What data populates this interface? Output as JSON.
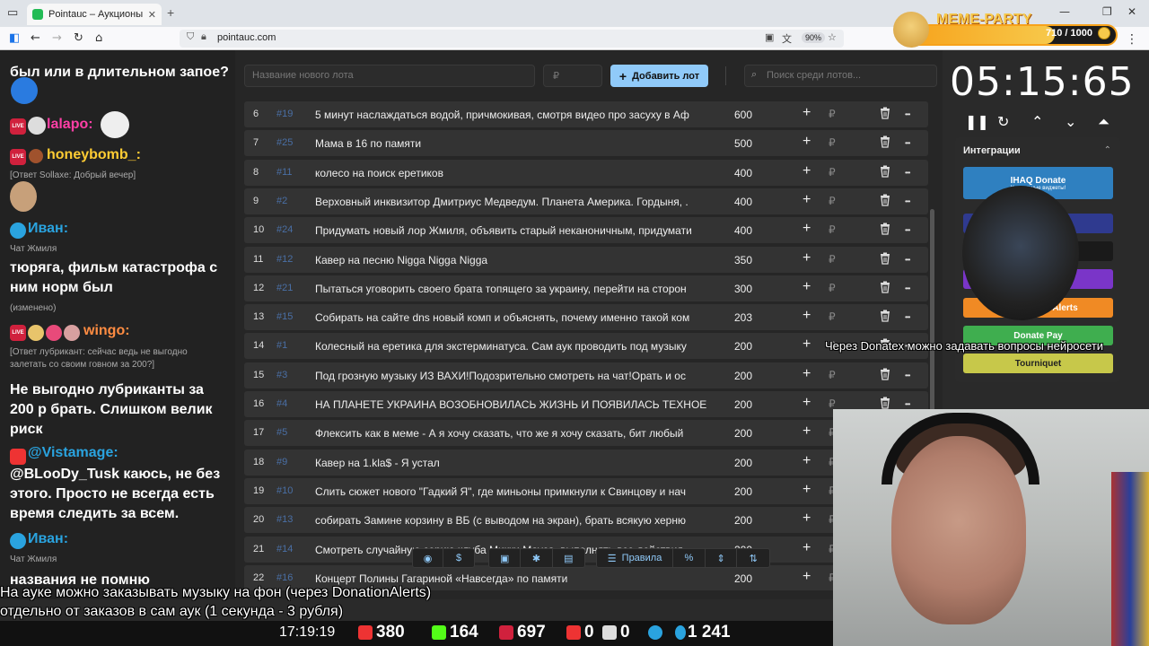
{
  "browser": {
    "tab_title": "Pointauc – Аукционы, лотереи",
    "tab_close": "✕",
    "new_tab": "+",
    "url": "pointauc.com",
    "zoom": "90%"
  },
  "chat": {
    "top_fragment": "был или в длительном запое?",
    "messages": [
      {
        "nick": "lalapo:",
        "nick_color": "#ff3fa6",
        "badge": "live"
      },
      {
        "nick": "honeybomb_:",
        "nick_color": "#ffcc33",
        "badge": "live",
        "meta": "[Ответ Sollaxe: Добрый вечер]"
      },
      {
        "nick": "Иван:",
        "nick_color": "#2aa3df",
        "badge": "tg",
        "meta": "Чат Жмиля",
        "text": "тюряга, фильм катастрофа с ним норм был",
        "meta2": "(изменено)"
      },
      {
        "nick": "wingo:",
        "nick_color": "#ff8c42",
        "badge": "live",
        "meta": "[Ответ лубрикант: сейчас ведь не выгодно залетать со своим говном за 200?]",
        "text": "Не выгодно лубриканты за 200 р брать. Слишком велик риск"
      },
      {
        "nick": "@Vistamage:",
        "nick_color": "#2aa3df",
        "badge": "yt",
        "text": "@BLooDy_Tusk каюсь, не без этого. Просто не всегда есть время следить за всем."
      },
      {
        "nick": "Иван:",
        "nick_color": "#2aa3df",
        "badge": "tg",
        "meta": "Чат Жмиля",
        "text": "названия не помню"
      }
    ]
  },
  "lots": {
    "new_lot_placeholder": "Название нового лота",
    "price_placeholder": "₽",
    "add_button": "Добавить лот",
    "search_placeholder": "Поиск среди лотов...",
    "currency": "₽",
    "rows": [
      {
        "n": "6",
        "id": "#19",
        "name": "5 минут наслаждаться водой, причмокивая, смотря видео про засуху в Аф",
        "amount": "600"
      },
      {
        "n": "7",
        "id": "#25",
        "name": "Мама в 16 по памяти",
        "amount": "500"
      },
      {
        "n": "8",
        "id": "#11",
        "name": "колесо на поиск еретиков",
        "amount": "400"
      },
      {
        "n": "9",
        "id": "#2",
        "name": "Верховный инквизитор Дмитриус Медведум. Планета Америка. Гордыня, .",
        "amount": "400"
      },
      {
        "n": "10",
        "id": "#24",
        "name": "Придумать новый лор Жмиля, объявить старый неканоничным, придумати",
        "amount": "400"
      },
      {
        "n": "11",
        "id": "#12",
        "name": "Кавер на песню Nigga Nigga Nigga",
        "amount": "350"
      },
      {
        "n": "12",
        "id": "#21",
        "name": "Пытаться уговорить своего брата топящего за украину, перейти на сторон",
        "amount": "300"
      },
      {
        "n": "13",
        "id": "#15",
        "name": "Собирать на сайте dns новый комп и объяснять, почему именно такой ком",
        "amount": "203"
      },
      {
        "n": "14",
        "id": "#1",
        "name": "Колесный на еретика для экстерминатуса. Сам аук проводить под музыку",
        "amount": "200"
      },
      {
        "n": "15",
        "id": "#3",
        "name": "Под грозную музыку ИЗ ВАХИ!Подозрительно смотреть на чат!Орать и ос",
        "amount": "200"
      },
      {
        "n": "16",
        "id": "#4",
        "name": "НА ПЛАНЕТЕ УКРАИНА ВОЗОБНОВИЛАСЬ ЖИЗНЬ И ПОЯВИЛАСЬ ТЕХНОЕ",
        "amount": "200"
      },
      {
        "n": "17",
        "id": "#5",
        "name": "Флексить как в меме - А я хочу сказать, что же я хочу сказать, бит любый",
        "amount": "200"
      },
      {
        "n": "18",
        "id": "#9",
        "name": "Кавер на 1.kla$ - Я устал",
        "amount": "200"
      },
      {
        "n": "19",
        "id": "#10",
        "name": "Слить сюжет нового \"Гадкий Я\", где миньоны примкнули к Свинцову и нач",
        "amount": "200"
      },
      {
        "n": "20",
        "id": "#13",
        "name": "собирать Замине корзину в ВБ (с выводом на экран), брать всякую херню",
        "amount": "200"
      },
      {
        "n": "21",
        "id": "#14",
        "name": "Смотреть случайную серию клуба Микки Мауса, выполнять все действия,",
        "amount": "200"
      },
      {
        "n": "22",
        "id": "#16",
        "name": "Концерт Полины Гагариной «Навсегда» по памяти",
        "amount": "200"
      }
    ]
  },
  "toolbar": {
    "rules_label": "Правила"
  },
  "timer": {
    "value": "05:15:65"
  },
  "integrations": {
    "title": "Интеграции",
    "buttons": [
      {
        "label": "IHAQ Donate",
        "sub": "Уникальные виджеты!",
        "color": "#2f80c0"
      },
      {
        "label": "",
        "color": "#2f3a8f"
      },
      {
        "label": "",
        "color": "#1a1a1a"
      },
      {
        "label": "",
        "color": "#7a35c8"
      },
      {
        "label": "Alerts",
        "color": "#f08a24"
      },
      {
        "label": "Donate Pay",
        "color": "#3fae4f"
      },
      {
        "label": "Tourniquet",
        "color": "#c7c84a"
      }
    ]
  },
  "overlay": {
    "caption_line1": "На ауке можно заказывать музыку на фон (через DonationAlerts)",
    "caption_line2": "отдельно от заказов в сам аук (1 секунда - 3 рубля)",
    "caption_right": "Через Donatex можно задавать вопросы нейросети",
    "clock": "17:19:19",
    "stats": [
      {
        "value": "380",
        "color": "#e33"
      },
      {
        "value": "164",
        "color": "#53fc18"
      },
      {
        "value": "697",
        "color": "#d0213d"
      },
      {
        "value": "0",
        "color": "#e33"
      },
      {
        "value": "0",
        "color": "#ddd"
      },
      {
        "value": "1 241",
        "color": "#2aa3df"
      }
    ]
  },
  "memeparty": {
    "title": "MEME-PARTY",
    "value": "710 / 1000",
    "progress": 0.71
  }
}
